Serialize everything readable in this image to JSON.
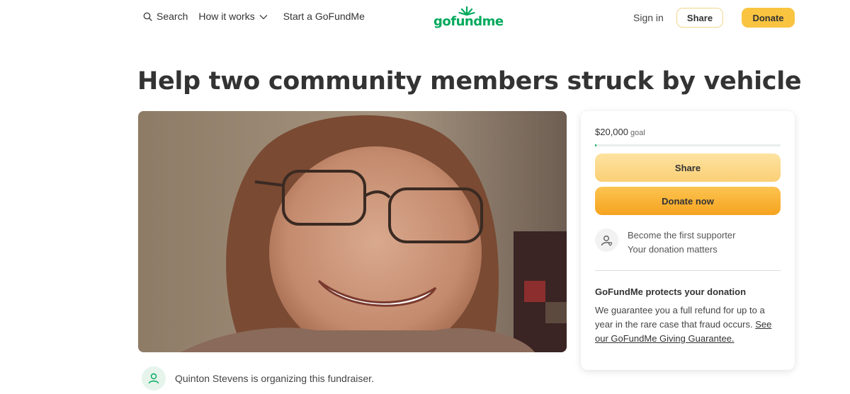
{
  "header": {
    "search_label": "Search",
    "how_it_works_label": "How it works",
    "start_label": "Start a GoFundMe",
    "logo_text": "gofundme",
    "signin_label": "Sign in",
    "share_label": "Share",
    "donate_label": "Donate",
    "brand_color": "#02a95c",
    "accent_color": "#f9c440"
  },
  "campaign": {
    "title": "Help two community members struck by vehicle",
    "organizer_text": "Quinton Stevens is organizing this fundraiser."
  },
  "sidebar": {
    "goal_amount": "$20,000",
    "goal_label": "goal",
    "progress_fraction": 0.0,
    "share_label": "Share",
    "donate_label": "Donate now",
    "supporter_line1": "Become the first supporter",
    "supporter_line2": "Your donation matters",
    "protect_title": "GoFundMe protects your donation",
    "protect_body": "We guarantee you a full refund for up to a year in the rare case that fraud occurs.",
    "protect_link": "See our GoFundMe Giving Guarantee."
  },
  "icons": {
    "search": "search-icon",
    "chevron": "chevron-down-icon",
    "organizer": "user-icon",
    "supporter": "user-heart-icon"
  }
}
